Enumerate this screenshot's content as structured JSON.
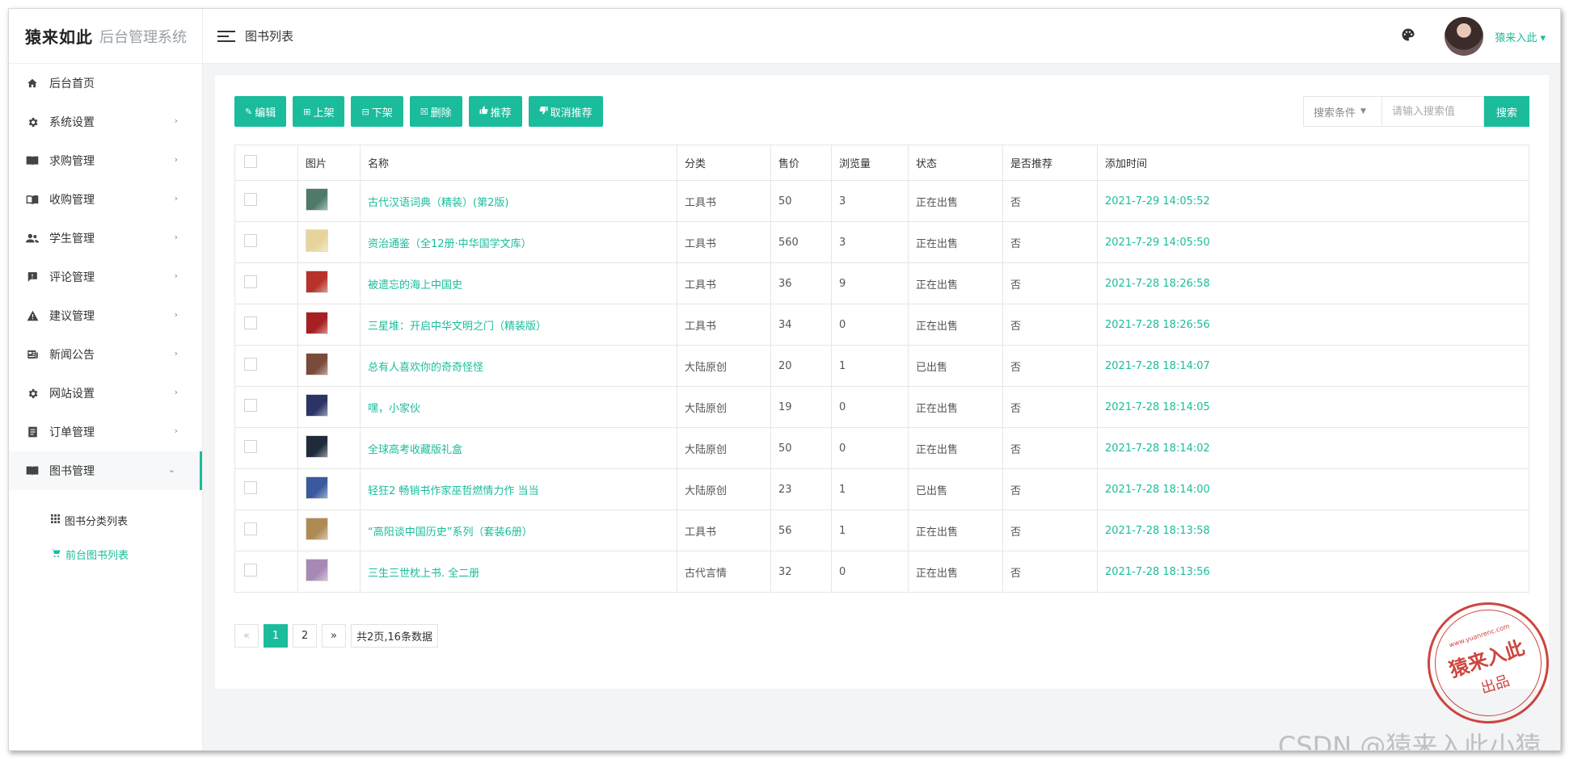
{
  "brand": {
    "logo_text": "猿来如此",
    "system_name": "后台管理系统"
  },
  "sidebar": {
    "items": [
      {
        "label": "后台首页",
        "icon": "home-icon",
        "has_arrow": false
      },
      {
        "label": "系统设置",
        "icon": "gear-icon",
        "has_arrow": true
      },
      {
        "label": "求购管理",
        "icon": "book-icon",
        "has_arrow": true
      },
      {
        "label": "收购管理",
        "icon": "book-open-icon",
        "has_arrow": true
      },
      {
        "label": "学生管理",
        "icon": "users-icon",
        "has_arrow": true
      },
      {
        "label": "评论管理",
        "icon": "comment-icon",
        "has_arrow": true
      },
      {
        "label": "建议管理",
        "icon": "warning-icon",
        "has_arrow": true
      },
      {
        "label": "新闻公告",
        "icon": "news-icon",
        "has_arrow": true
      },
      {
        "label": "网站设置",
        "icon": "gear-icon",
        "has_arrow": true
      },
      {
        "label": "订单管理",
        "icon": "order-icon",
        "has_arrow": true
      },
      {
        "label": "图书管理",
        "icon": "book-icon",
        "has_arrow": true,
        "open": true
      }
    ],
    "submenu": [
      {
        "label": "图书分类列表",
        "icon": "grid-icon",
        "active": false
      },
      {
        "label": "前台图书列表",
        "icon": "cart-icon",
        "active": true
      }
    ]
  },
  "header": {
    "page_title": "图书列表",
    "username": "猿来入此",
    "username_caret": "▾"
  },
  "toolbar": {
    "buttons": [
      {
        "label": "编辑",
        "icon": "pencil-icon"
      },
      {
        "label": "上架",
        "icon": "plus-square-icon"
      },
      {
        "label": "下架",
        "icon": "minus-square-icon"
      },
      {
        "label": "删除",
        "icon": "x-square-icon"
      },
      {
        "label": "推荐",
        "icon": "thumbs-up-icon"
      },
      {
        "label": "取消推荐",
        "icon": "thumbs-down-icon"
      }
    ]
  },
  "search": {
    "condition_label": "搜索条件",
    "placeholder": "请输入搜索值",
    "button_label": "搜索"
  },
  "table": {
    "columns": [
      "图片",
      "名称",
      "分类",
      "售价",
      "浏览量",
      "状态",
      "是否推荐",
      "添加时间"
    ],
    "rows": [
      {
        "name": "古代汉语词典（精装）(第2版)",
        "category": "工具书",
        "price": "50",
        "views": "3",
        "status": "正在出售",
        "recommended": "否",
        "added": "2021-7-29 14:05:52",
        "thumb_color": "#4f7a6a"
      },
      {
        "name": "资治通鉴（全12册·中华国学文库）",
        "category": "工具书",
        "price": "560",
        "views": "3",
        "status": "正在出售",
        "recommended": "否",
        "added": "2021-7-29 14:05:50",
        "thumb_color": "#e7d49a"
      },
      {
        "name": "被遗忘的海上中国史",
        "category": "工具书",
        "price": "36",
        "views": "9",
        "status": "正在出售",
        "recommended": "否",
        "added": "2021-7-28 18:26:58",
        "thumb_color": "#b8322b"
      },
      {
        "name": "三星堆：开启中华文明之门（精装版）",
        "category": "工具书",
        "price": "34",
        "views": "0",
        "status": "正在出售",
        "recommended": "否",
        "added": "2021-7-28 18:26:56",
        "thumb_color": "#a81f23"
      },
      {
        "name": "总有人喜欢你的奇奇怪怪",
        "category": "大陆原创",
        "price": "20",
        "views": "1",
        "status": "已出售",
        "recommended": "否",
        "added": "2021-7-28 18:14:07",
        "thumb_color": "#7a4a3a"
      },
      {
        "name": "嘿，小家伙",
        "category": "大陆原创",
        "price": "19",
        "views": "0",
        "status": "正在出售",
        "recommended": "否",
        "added": "2021-7-28 18:14:05",
        "thumb_color": "#2a3566"
      },
      {
        "name": "全球高考收藏版礼盒",
        "category": "大陆原创",
        "price": "50",
        "views": "0",
        "status": "正在出售",
        "recommended": "否",
        "added": "2021-7-28 18:14:02",
        "thumb_color": "#1f2b3a"
      },
      {
        "name": "轻狂2 畅销书作家巫哲燃情力作 当当",
        "category": "大陆原创",
        "price": "23",
        "views": "1",
        "status": "已出售",
        "recommended": "否",
        "added": "2021-7-28 18:14:00",
        "thumb_color": "#3a5aa0"
      },
      {
        "name": "“高阳谈中国历史”系列（套装6册）",
        "category": "工具书",
        "price": "56",
        "views": "1",
        "status": "正在出售",
        "recommended": "否",
        "added": "2021-7-28 18:13:58",
        "thumb_color": "#b08a55"
      },
      {
        "name": "三生三世枕上书. 全二册",
        "category": "古代言情",
        "price": "32",
        "views": "0",
        "status": "正在出售",
        "recommended": "否",
        "added": "2021-7-28 18:13:56",
        "thumb_color": "#a888b5"
      }
    ]
  },
  "pagination": {
    "prev": "«",
    "pages": [
      "1",
      "2"
    ],
    "current": "1",
    "next": "»",
    "summary": "共2页,16条数据"
  },
  "watermark": {
    "stamp_url": "www.yuanrenc.com",
    "stamp_name": "猿来入此",
    "stamp_sub": "出品",
    "csdn": "CSDN @猿来入此小猿"
  },
  "colors": {
    "accent": "#1abc9c",
    "stamp": "#c9312a"
  }
}
